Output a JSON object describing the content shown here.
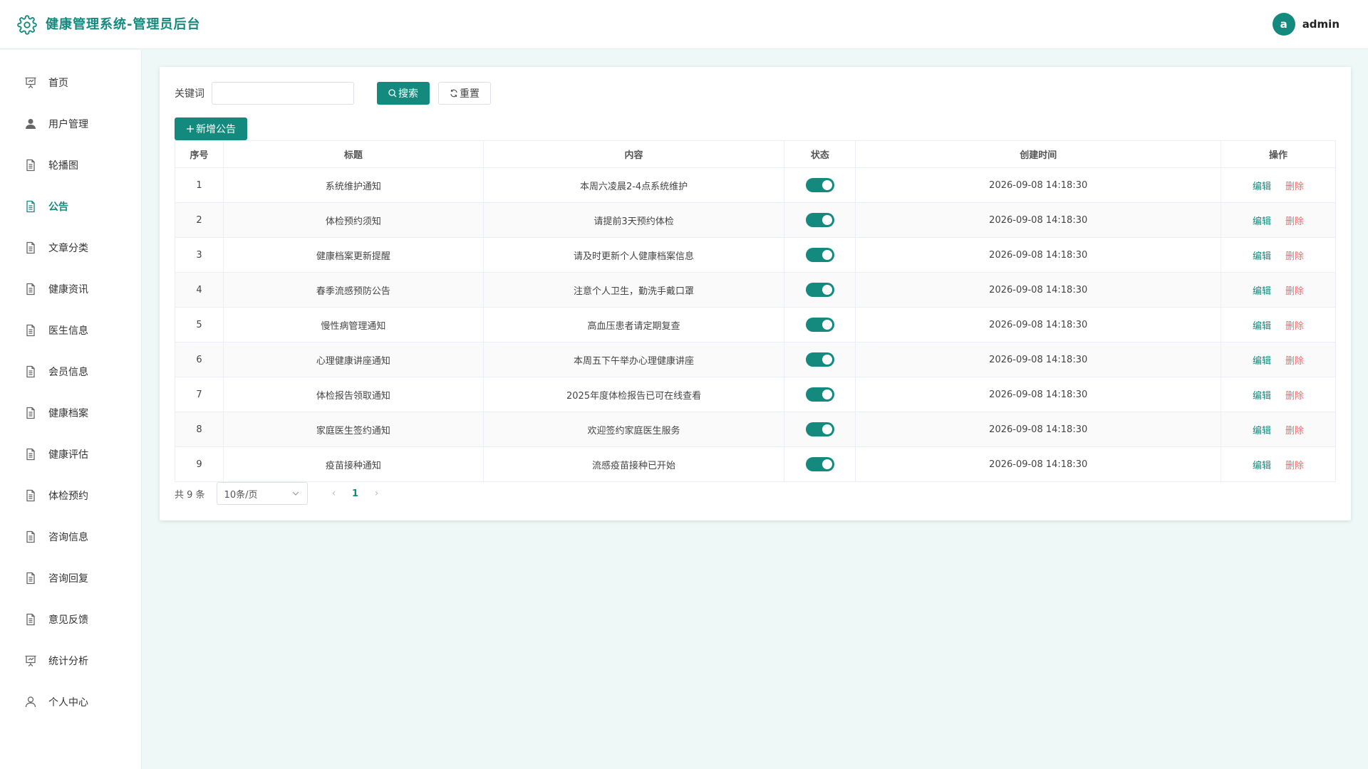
{
  "app": {
    "title": "健康管理系统-管理员后台",
    "brand_color": "#148a7e"
  },
  "user": {
    "avatar_letter": "a",
    "name": "admin"
  },
  "sidebar": {
    "items": [
      {
        "label": "首页",
        "icon": "presentation-icon"
      },
      {
        "label": "用户管理",
        "icon": "user-icon"
      },
      {
        "label": "轮播图",
        "icon": "document-icon"
      },
      {
        "label": "公告",
        "icon": "document-icon",
        "active": true
      },
      {
        "label": "文章分类",
        "icon": "document-icon"
      },
      {
        "label": "健康资讯",
        "icon": "document-icon"
      },
      {
        "label": "医生信息",
        "icon": "document-icon"
      },
      {
        "label": "会员信息",
        "icon": "document-icon"
      },
      {
        "label": "健康档案",
        "icon": "document-icon"
      },
      {
        "label": "健康评估",
        "icon": "document-icon"
      },
      {
        "label": "体检预约",
        "icon": "document-icon"
      },
      {
        "label": "咨询信息",
        "icon": "document-icon"
      },
      {
        "label": "咨询回复",
        "icon": "document-icon"
      },
      {
        "label": "意见反馈",
        "icon": "document-icon"
      },
      {
        "label": "统计分析",
        "icon": "presentation-icon"
      },
      {
        "label": "个人中心",
        "icon": "user-outline-icon"
      }
    ]
  },
  "search": {
    "keyword_label": "关键词",
    "keyword_value": "",
    "search_label": "搜索",
    "reset_label": "重置"
  },
  "add_label": "新增公告",
  "table": {
    "headers": [
      "序号",
      "标题",
      "内容",
      "状态",
      "创建时间",
      "操作"
    ],
    "edit_label": "编辑",
    "delete_label": "删除",
    "rows": [
      {
        "no": "1",
        "title": "系统维护通知",
        "content": "本周六凌晨2-4点系统维护",
        "status": true,
        "created": "2026-09-08 14:18:30"
      },
      {
        "no": "2",
        "title": "体检预约须知",
        "content": "请提前3天预约体检",
        "status": true,
        "created": "2026-09-08 14:18:30"
      },
      {
        "no": "3",
        "title": "健康档案更新提醒",
        "content": "请及时更新个人健康档案信息",
        "status": true,
        "created": "2026-09-08 14:18:30"
      },
      {
        "no": "4",
        "title": "春季流感预防公告",
        "content": "注意个人卫生，勤洗手戴口罩",
        "status": true,
        "created": "2026-09-08 14:18:30"
      },
      {
        "no": "5",
        "title": "慢性病管理通知",
        "content": "高血压患者请定期复查",
        "status": true,
        "created": "2026-09-08 14:18:30"
      },
      {
        "no": "6",
        "title": "心理健康讲座通知",
        "content": "本周五下午举办心理健康讲座",
        "status": true,
        "created": "2026-09-08 14:18:30"
      },
      {
        "no": "7",
        "title": "体检报告领取通知",
        "content": "2025年度体检报告已可在线查看",
        "status": true,
        "created": "2026-09-08 14:18:30"
      },
      {
        "no": "8",
        "title": "家庭医生签约通知",
        "content": "欢迎签约家庭医生服务",
        "status": true,
        "created": "2026-09-08 14:18:30"
      },
      {
        "no": "9",
        "title": "疫苗接种通知",
        "content": "流感疫苗接种已开始",
        "status": true,
        "created": "2026-09-08 14:18:30"
      }
    ]
  },
  "pagination": {
    "total_text": "共 9 条",
    "page_size": "10条/页",
    "current_page": "1"
  }
}
